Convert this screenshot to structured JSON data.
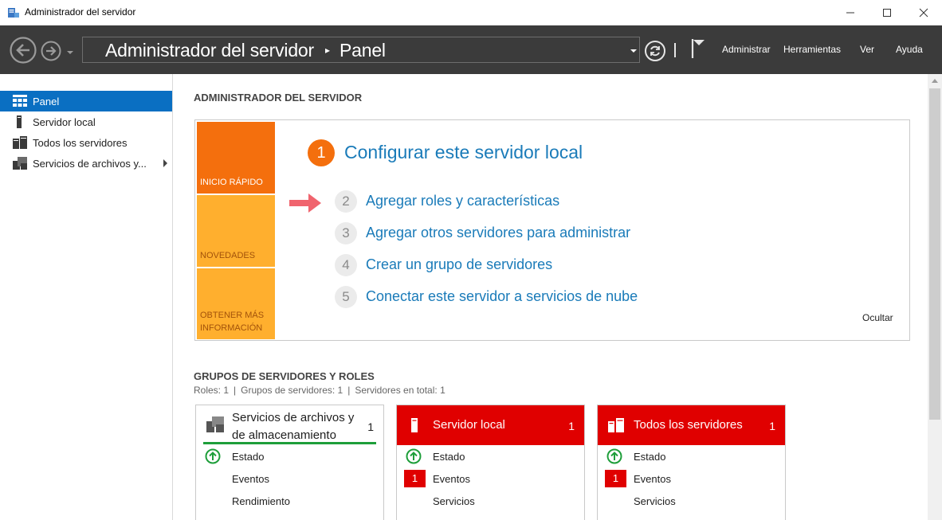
{
  "window": {
    "title": "Administrador del servidor"
  },
  "commandbar": {
    "breadcrumb_root": "Administrador del servidor",
    "breadcrumb_separator": "▸",
    "breadcrumb_current": "Panel",
    "menu": [
      "Administrar",
      "Herramientas",
      "Ver",
      "Ayuda"
    ]
  },
  "sidebar": {
    "items": [
      {
        "label": "Panel",
        "icon": "dashboard-icon",
        "active": true
      },
      {
        "label": "Servidor local",
        "icon": "server-icon"
      },
      {
        "label": "Todos los servidores",
        "icon": "servers-icon"
      },
      {
        "label": "Servicios de archivos y...",
        "icon": "file-services-icon",
        "has_submenu": true
      }
    ]
  },
  "main": {
    "section_title": "ADMINISTRADOR DEL SERVIDOR",
    "welcome": {
      "tiles": [
        {
          "label": "INICIO RÁPIDO",
          "color": "#f46f0d"
        },
        {
          "label": "NOVEDADES",
          "color": "#ffaf2e"
        },
        {
          "label": "OBTENER MÁS INFORMACIÓN",
          "color": "#ffaf2e"
        }
      ],
      "steps": [
        {
          "num": "1",
          "label": "Configurar este servidor local"
        },
        {
          "num": "2",
          "label": "Agregar roles y características"
        },
        {
          "num": "3",
          "label": "Agregar otros servidores para administrar"
        },
        {
          "num": "4",
          "label": "Crear un grupo de servidores"
        },
        {
          "num": "5",
          "label": "Conectar este servidor a servicios de nube"
        }
      ],
      "hide_label": "Ocultar"
    },
    "groups": {
      "title": "GRUPOS DE SERVIDORES Y ROLES",
      "stats": [
        "Roles: 1",
        "Grupos de servidores: 1",
        "Servidores en total: 1"
      ],
      "stats_separator": "|",
      "cards": [
        {
          "title_line1": "Servicios de archivos y",
          "title_line2": "de almacenamiento",
          "count": "1",
          "status": "ok",
          "rows": [
            {
              "label": "Estado",
              "status": "ok"
            },
            {
              "label": "Eventos"
            },
            {
              "label": "Rendimiento"
            }
          ]
        },
        {
          "title": "Servidor local",
          "count": "1",
          "status": "alert",
          "rows": [
            {
              "label": "Estado",
              "status": "ok"
            },
            {
              "label": "Eventos",
              "badge": "1"
            },
            {
              "label": "Servicios"
            }
          ]
        },
        {
          "title": "Todos los servidores",
          "count": "1",
          "status": "alert",
          "rows": [
            {
              "label": "Estado",
              "status": "ok"
            },
            {
              "label": "Eventos",
              "badge": "1"
            },
            {
              "label": "Servicios"
            }
          ]
        }
      ]
    }
  },
  "colors": {
    "accent": "#0a6fc2",
    "link": "#1a7bb9",
    "alert": "#e00000",
    "ok": "#1e9e3a",
    "step_active": "#f46f0d"
  }
}
